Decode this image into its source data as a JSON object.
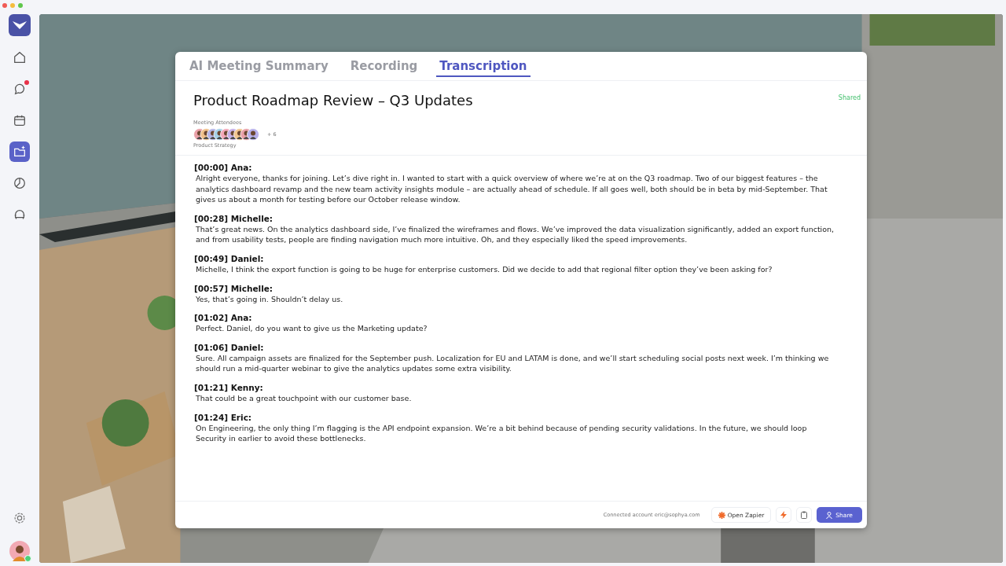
{
  "sidebar": {
    "items": [
      {
        "kind": "home",
        "selected": false,
        "unread": false
      },
      {
        "kind": "chat",
        "selected": false,
        "unread": true
      },
      {
        "kind": "calendar",
        "selected": false,
        "unread": false
      },
      {
        "kind": "folder",
        "selected": true,
        "unread": false
      },
      {
        "kind": "chart",
        "selected": false,
        "unread": false
      },
      {
        "kind": "lounge",
        "selected": false,
        "unread": false
      }
    ],
    "footer": [
      {
        "kind": "settings"
      }
    ],
    "user": {
      "online": true
    }
  },
  "tabs": [
    {
      "label": "AI Meeting Summary",
      "selected": false
    },
    {
      "label": "Recording",
      "selected": false
    },
    {
      "label": "Transcription",
      "selected": true
    }
  ],
  "meeting": {
    "title": "Product Roadmap Review – Q3 Updates",
    "status": "Shared",
    "attendees_label": "Meeting Attendees",
    "more_attendees": "+ 6",
    "team": "Product Strategy"
  },
  "transcript": [
    {
      "time": "[00:00]",
      "speaker": "Ana:",
      "text": "Alright everyone, thanks for joining. Let’s dive right in. I wanted to start with a quick overview of where we’re at on the Q3 roadmap. Two of our biggest features – the analytics dashboard revamp and the new team activity insights module – are actually ahead of schedule. If all goes well, both should be in beta by mid-September. That gives us about a month for testing before our October release window."
    },
    {
      "time": "[00:28]",
      "speaker": "Michelle:",
      "text": "That’s great news. On the analytics dashboard side, I’ve finalized the wireframes and flows. We’ve improved the data visualization significantly, added an export function, and from usability tests, people are finding navigation much more intuitive. Oh, and they especially liked the speed improvements."
    },
    {
      "time": "[00:49]",
      "speaker": "Daniel:",
      "text": "Michelle, I think the export function is going to be huge for enterprise customers. Did we decide to add that regional filter option they’ve been asking for?"
    },
    {
      "time": "[00:57]",
      "speaker": "Michelle:",
      "text": "Yes, that’s going in. Shouldn’t delay us."
    },
    {
      "time": "[01:02]",
      "speaker": "Ana:",
      "text": "Perfect. Daniel, do you want to give us the Marketing update?"
    },
    {
      "time": "[01:06]",
      "speaker": "Daniel:",
      "text": "Sure. All campaign assets are finalized for the September push. Localization for EU and LATAM is done, and we’ll start scheduling social posts next week. I’m thinking we should run a mid-quarter webinar to give the analytics updates some extra visibility."
    },
    {
      "time": "[01:21]",
      "speaker": "Kenny:",
      "text": "That could be a great touchpoint with our customer base."
    },
    {
      "time": "[01:24]",
      "speaker": "Eric:",
      "text": "On Engineering, the only thing I’m flagging is the API endpoint expansion. We’re a bit behind because of pending security validations. In the future, we should loop Security in earlier to avoid these bottlenecks."
    }
  ],
  "footer": {
    "account": "Connected account eric@sophya.com",
    "zapier_button": "Open Zapier",
    "share_button": "Share"
  }
}
